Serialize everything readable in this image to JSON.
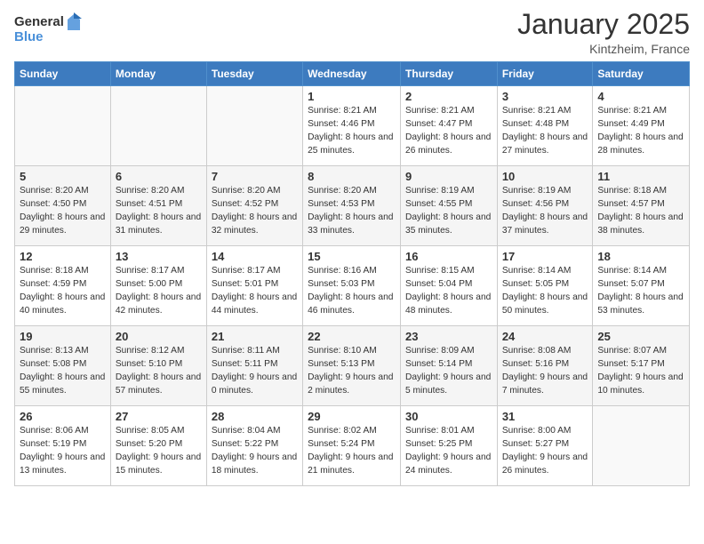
{
  "header": {
    "logo_general": "General",
    "logo_blue": "Blue",
    "month": "January 2025",
    "location": "Kintzheim, France"
  },
  "weekdays": [
    "Sunday",
    "Monday",
    "Tuesday",
    "Wednesday",
    "Thursday",
    "Friday",
    "Saturday"
  ],
  "weeks": [
    [
      {
        "day": "",
        "info": ""
      },
      {
        "day": "",
        "info": ""
      },
      {
        "day": "",
        "info": ""
      },
      {
        "day": "1",
        "info": "Sunrise: 8:21 AM\nSunset: 4:46 PM\nDaylight: 8 hours and 25 minutes."
      },
      {
        "day": "2",
        "info": "Sunrise: 8:21 AM\nSunset: 4:47 PM\nDaylight: 8 hours and 26 minutes."
      },
      {
        "day": "3",
        "info": "Sunrise: 8:21 AM\nSunset: 4:48 PM\nDaylight: 8 hours and 27 minutes."
      },
      {
        "day": "4",
        "info": "Sunrise: 8:21 AM\nSunset: 4:49 PM\nDaylight: 8 hours and 28 minutes."
      }
    ],
    [
      {
        "day": "5",
        "info": "Sunrise: 8:20 AM\nSunset: 4:50 PM\nDaylight: 8 hours and 29 minutes."
      },
      {
        "day": "6",
        "info": "Sunrise: 8:20 AM\nSunset: 4:51 PM\nDaylight: 8 hours and 31 minutes."
      },
      {
        "day": "7",
        "info": "Sunrise: 8:20 AM\nSunset: 4:52 PM\nDaylight: 8 hours and 32 minutes."
      },
      {
        "day": "8",
        "info": "Sunrise: 8:20 AM\nSunset: 4:53 PM\nDaylight: 8 hours and 33 minutes."
      },
      {
        "day": "9",
        "info": "Sunrise: 8:19 AM\nSunset: 4:55 PM\nDaylight: 8 hours and 35 minutes."
      },
      {
        "day": "10",
        "info": "Sunrise: 8:19 AM\nSunset: 4:56 PM\nDaylight: 8 hours and 37 minutes."
      },
      {
        "day": "11",
        "info": "Sunrise: 8:18 AM\nSunset: 4:57 PM\nDaylight: 8 hours and 38 minutes."
      }
    ],
    [
      {
        "day": "12",
        "info": "Sunrise: 8:18 AM\nSunset: 4:59 PM\nDaylight: 8 hours and 40 minutes."
      },
      {
        "day": "13",
        "info": "Sunrise: 8:17 AM\nSunset: 5:00 PM\nDaylight: 8 hours and 42 minutes."
      },
      {
        "day": "14",
        "info": "Sunrise: 8:17 AM\nSunset: 5:01 PM\nDaylight: 8 hours and 44 minutes."
      },
      {
        "day": "15",
        "info": "Sunrise: 8:16 AM\nSunset: 5:03 PM\nDaylight: 8 hours and 46 minutes."
      },
      {
        "day": "16",
        "info": "Sunrise: 8:15 AM\nSunset: 5:04 PM\nDaylight: 8 hours and 48 minutes."
      },
      {
        "day": "17",
        "info": "Sunrise: 8:14 AM\nSunset: 5:05 PM\nDaylight: 8 hours and 50 minutes."
      },
      {
        "day": "18",
        "info": "Sunrise: 8:14 AM\nSunset: 5:07 PM\nDaylight: 8 hours and 53 minutes."
      }
    ],
    [
      {
        "day": "19",
        "info": "Sunrise: 8:13 AM\nSunset: 5:08 PM\nDaylight: 8 hours and 55 minutes."
      },
      {
        "day": "20",
        "info": "Sunrise: 8:12 AM\nSunset: 5:10 PM\nDaylight: 8 hours and 57 minutes."
      },
      {
        "day": "21",
        "info": "Sunrise: 8:11 AM\nSunset: 5:11 PM\nDaylight: 9 hours and 0 minutes."
      },
      {
        "day": "22",
        "info": "Sunrise: 8:10 AM\nSunset: 5:13 PM\nDaylight: 9 hours and 2 minutes."
      },
      {
        "day": "23",
        "info": "Sunrise: 8:09 AM\nSunset: 5:14 PM\nDaylight: 9 hours and 5 minutes."
      },
      {
        "day": "24",
        "info": "Sunrise: 8:08 AM\nSunset: 5:16 PM\nDaylight: 9 hours and 7 minutes."
      },
      {
        "day": "25",
        "info": "Sunrise: 8:07 AM\nSunset: 5:17 PM\nDaylight: 9 hours and 10 minutes."
      }
    ],
    [
      {
        "day": "26",
        "info": "Sunrise: 8:06 AM\nSunset: 5:19 PM\nDaylight: 9 hours and 13 minutes."
      },
      {
        "day": "27",
        "info": "Sunrise: 8:05 AM\nSunset: 5:20 PM\nDaylight: 9 hours and 15 minutes."
      },
      {
        "day": "28",
        "info": "Sunrise: 8:04 AM\nSunset: 5:22 PM\nDaylight: 9 hours and 18 minutes."
      },
      {
        "day": "29",
        "info": "Sunrise: 8:02 AM\nSunset: 5:24 PM\nDaylight: 9 hours and 21 minutes."
      },
      {
        "day": "30",
        "info": "Sunrise: 8:01 AM\nSunset: 5:25 PM\nDaylight: 9 hours and 24 minutes."
      },
      {
        "day": "31",
        "info": "Sunrise: 8:00 AM\nSunset: 5:27 PM\nDaylight: 9 hours and 26 minutes."
      },
      {
        "day": "",
        "info": ""
      }
    ]
  ]
}
